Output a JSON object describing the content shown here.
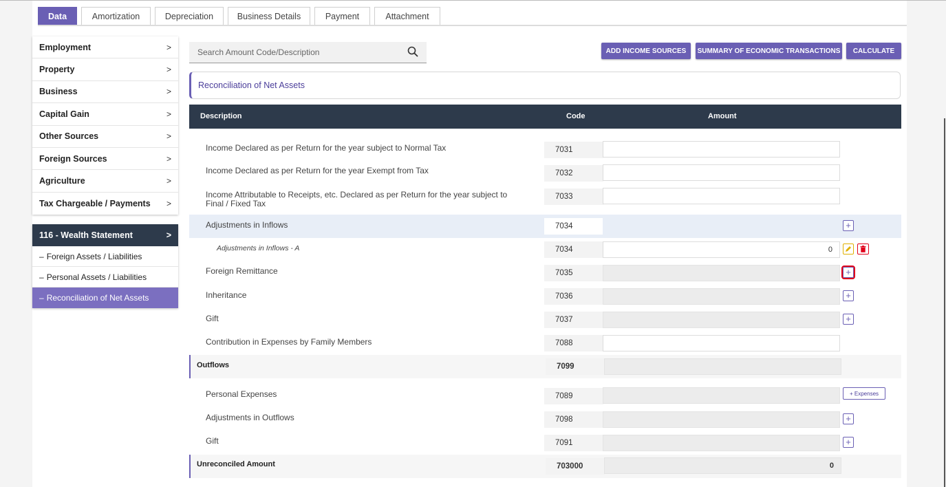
{
  "tabs": [
    {
      "label": "Data",
      "active": true
    },
    {
      "label": "Amortization"
    },
    {
      "label": "Depreciation"
    },
    {
      "label": "Business Details"
    },
    {
      "label": "Payment"
    },
    {
      "label": "Attachment"
    }
  ],
  "sidebar": {
    "items": [
      {
        "label": "Employment",
        "chevron": ">"
      },
      {
        "label": "Property",
        "chevron": ">"
      },
      {
        "label": "Business",
        "chevron": ">"
      },
      {
        "label": "Capital Gain",
        "chevron": ">"
      },
      {
        "label": "Other Sources",
        "chevron": ">"
      },
      {
        "label": "Foreign Sources",
        "chevron": ">"
      },
      {
        "label": "Agriculture",
        "chevron": ">"
      },
      {
        "label": "Tax Chargeable / Payments",
        "chevron": ">"
      }
    ]
  },
  "wealth": {
    "title": "116 - Wealth Statement",
    "chevron": ">",
    "dash": "–",
    "items": [
      {
        "label": "Foreign Assets / Liabilities"
      },
      {
        "label": "Personal Assets / Liabilities"
      },
      {
        "label": "Reconciliation of Net Assets",
        "active": true
      }
    ]
  },
  "search": {
    "placeholder": "Search Amount Code/Description"
  },
  "actions": {
    "add_income": "ADD INCOME SOURCES",
    "summary": "SUMMARY OF ECONOMIC TRANSACTIONS",
    "calculate": "CALCULATE"
  },
  "section_title": "Reconciliation of Net Assets",
  "table": {
    "headers": {
      "description": "Description",
      "code": "Code",
      "amount": "Amount"
    },
    "rows": [
      {
        "description": "Income Declared as per Return for the year subject to Normal Tax",
        "code": "7031",
        "amount": ""
      },
      {
        "description": "Income Declared as per Return for the year Exempt from Tax",
        "code": "7032",
        "amount": ""
      },
      {
        "description": "Income Attributable to Receipts, etc. Declared as per Return for the year subject to Final / Fixed Tax",
        "code": "7033",
        "amount": ""
      },
      {
        "description": "Adjustments in Inflows",
        "code": "7034",
        "amount": ""
      },
      {
        "description": "Adjustments in Inflows - A",
        "code": "7034",
        "amount": "0"
      },
      {
        "description": "Foreign Remittance",
        "code": "7035",
        "amount": ""
      },
      {
        "description": "Inheritance",
        "code": "7036",
        "amount": ""
      },
      {
        "description": "Gift",
        "code": "7037",
        "amount": ""
      },
      {
        "description": "Contribution in Expenses by Family Members",
        "code": "7088",
        "amount": ""
      },
      {
        "description": "Outflows",
        "code": "7099",
        "amount": ""
      },
      {
        "description": "Personal Expenses",
        "code": "7089",
        "amount": "",
        "button": "+ Expenses"
      },
      {
        "description": "Adjustments in Outflows",
        "code": "7098",
        "amount": ""
      },
      {
        "description": "Gift",
        "code": "7091",
        "amount": ""
      },
      {
        "description": "Unreconciled Amount",
        "code": "703000",
        "amount": "0"
      }
    ]
  },
  "icons": {
    "search": "search-icon",
    "add": "plus-icon",
    "edit": "pencil-icon",
    "delete": "trash-icon"
  },
  "colors": {
    "accent": "#6a5fb4",
    "header": "#2d3a4b",
    "highlight": "#e8eef7",
    "danger": "#e0001a",
    "warning": "#e0b000"
  }
}
